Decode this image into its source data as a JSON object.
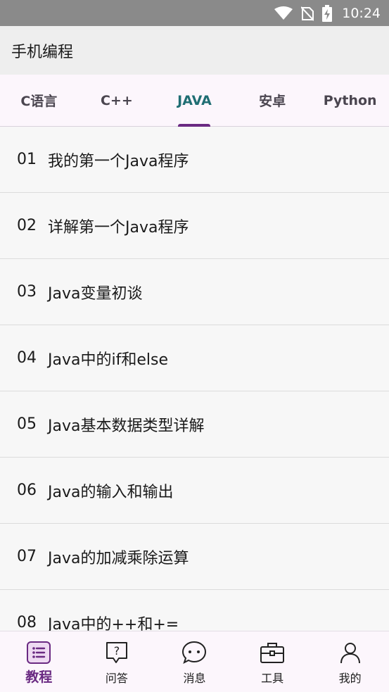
{
  "status_bar": {
    "time": "10:24",
    "icons": [
      "wifi-icon",
      "no-sim-icon",
      "battery-charging-icon"
    ]
  },
  "app_bar": {
    "title": "手机编程"
  },
  "tabs": [
    {
      "label": "C语言",
      "active": false
    },
    {
      "label": "C++",
      "active": false
    },
    {
      "label": "JAVA",
      "active": true
    },
    {
      "label": "安卓",
      "active": false
    },
    {
      "label": "Python",
      "active": false
    }
  ],
  "lessons": [
    {
      "num": "01",
      "title": "我的第一个Java程序"
    },
    {
      "num": "02",
      "title": "详解第一个Java程序"
    },
    {
      "num": "03",
      "title": "Java变量初谈"
    },
    {
      "num": "04",
      "title": "Java中的if和else"
    },
    {
      "num": "05",
      "title": "Java基本数据类型详解"
    },
    {
      "num": "06",
      "title": "Java的输入和输出"
    },
    {
      "num": "07",
      "title": "Java的加减乘除运算"
    },
    {
      "num": "08",
      "title": "Java中的++和+="
    }
  ],
  "bottom_nav": [
    {
      "label": "教程",
      "icon": "list-icon",
      "active": true
    },
    {
      "label": "问答",
      "icon": "question-icon",
      "active": false
    },
    {
      "label": "消息",
      "icon": "chat-icon",
      "active": false
    },
    {
      "label": "工具",
      "icon": "toolbox-icon",
      "active": false
    },
    {
      "label": "我的",
      "icon": "person-icon",
      "active": false
    }
  ],
  "colors": {
    "accent": "#6a2a82",
    "active_tab_text": "#1f6e73",
    "status_bar": "#8a8a8a"
  }
}
